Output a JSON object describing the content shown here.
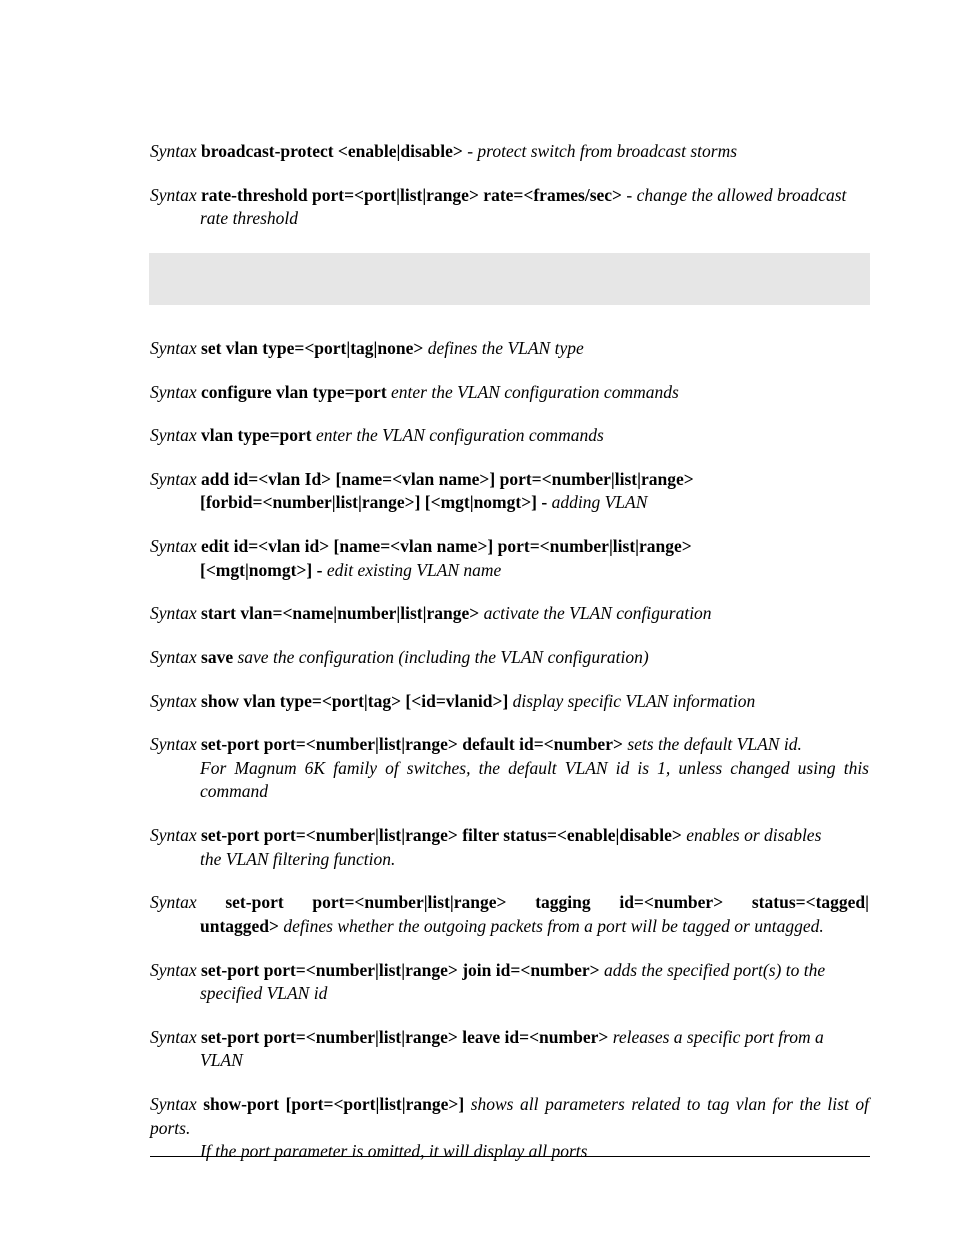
{
  "label": "Syntax",
  "entries": [
    {
      "cmd": " broadcast-protect <enable|disable> ",
      "desc": "- protect switch from broadcast storms",
      "cont_cmd": "",
      "cont_desc": ""
    },
    {
      "cmd": " rate-threshold port=<port|list|range> rate=<frames/sec> ",
      "desc": "- change the allowed broadcast",
      "cont_cmd": "",
      "cont_desc": "rate threshold"
    }
  ],
  "entries2": [
    {
      "cmd": " set vlan type=<port|tag|none> ",
      "desc": "defines the VLAN type",
      "cont_cmd": "",
      "cont_desc": ""
    },
    {
      "cmd": " configure vlan type=port ",
      "desc": "enter the VLAN configuration commands",
      "cont_cmd": "",
      "cont_desc": ""
    },
    {
      "cmd": "  vlan type=port ",
      "desc": "enter the VLAN configuration commands",
      "cont_cmd": "",
      "cont_desc": ""
    },
    {
      "cmd": " add id=<vlan Id> [name=<vlan name>] port=<number|list|range>",
      "desc": "",
      "cont_cmd": " [forbid=<number|list|range>] [<mgt|nomgt>] -  ",
      "cont_desc": "adding VLAN"
    },
    {
      "cmd": " edit  id=<vlan id> [name=<vlan name>] port=<number|list|range>",
      "desc": "",
      "cont_cmd": "[<mgt|nomgt>] - ",
      "cont_desc": "edit existing VLAN name"
    },
    {
      "cmd": " start vlan=<name|number|list|range> ",
      "desc": "activate the VLAN configuration",
      "cont_cmd": "",
      "cont_desc": ""
    },
    {
      "cmd": " save ",
      "desc": "save the configuration (including the VLAN configuration)",
      "cont_cmd": "",
      "cont_desc": ""
    },
    {
      "cmd": " show vlan type=<port|tag> [<id=vlanid>] ",
      "desc": "display specific VLAN information",
      "cont_cmd": "",
      "cont_desc": ""
    },
    {
      "cmd": " set-port port=<number|list|range> default id=<number> ",
      "desc": "sets the default VLAN id.",
      "cont_cmd": "",
      "cont_desc": "For Magnum 6K family of switches, the default VLAN id is 1, unless changed using this command"
    },
    {
      "cmd": " set-port port=<number|list|range> filter status=<enable|disable> ",
      "desc": "enables or disables",
      "cont_cmd": "",
      "cont_desc": "the VLAN filtering function."
    },
    {
      "cmd": " set-port port=<number|list|range> tagging id=<number> status=<tagged| untagged> ",
      "desc": "defines whether the outgoing packets from a port will be tagged or untagged.",
      "cont_cmd": "",
      "cont_desc": "",
      "twoLineCmd": true,
      "line1": " set-port port=<number|list|range> tagging id=<number> status=<tagged|",
      "line2cmd": "untagged> ",
      "line2desc": "defines whether the outgoing packets from a port will be tagged or untagged."
    },
    {
      "cmd": " set-port port=<number|list|range> join id=<number> ",
      "desc": "adds the specified port(s) to the",
      "cont_cmd": "",
      "cont_desc": "specified VLAN  id"
    },
    {
      "cmd": " set-port port=<number|list|range> leave id=<number> ",
      "desc": "releases a specific port from a",
      "cont_cmd": "",
      "cont_desc": "VLAN"
    },
    {
      "cmd": " show-port [port=<port|list|range>] ",
      "desc": "shows all parameters related to tag vlan for the list of ports.",
      "cont_cmd": "",
      "cont_desc": "If the port parameter is omitted, it will display all ports"
    }
  ]
}
